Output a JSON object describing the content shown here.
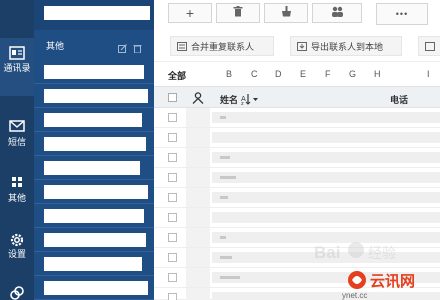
{
  "rail": {
    "items": [
      {
        "label": "通讯录",
        "icon": "contacts-icon"
      },
      {
        "label": "短信",
        "icon": "mail-icon"
      },
      {
        "label": "其他",
        "icon": "grid-icon"
      },
      {
        "label": "设置",
        "icon": "gear-icon"
      }
    ]
  },
  "list": {
    "group_title": "其他"
  },
  "toolbar": {
    "add": "+",
    "more": "•••"
  },
  "actions": {
    "merge": "合并重复联系人",
    "export": "导出联系人到本地"
  },
  "filter": {
    "all": "全部",
    "letters": [
      "B",
      "C",
      "D",
      "E",
      "F",
      "G",
      "H"
    ],
    "extra": "I"
  },
  "table": {
    "name_header": "姓名",
    "phone_header": "电话"
  },
  "colors": {
    "rail_bg": "#1b3f67",
    "list_bg": "#1f4e85",
    "accent": "#e4401f"
  }
}
